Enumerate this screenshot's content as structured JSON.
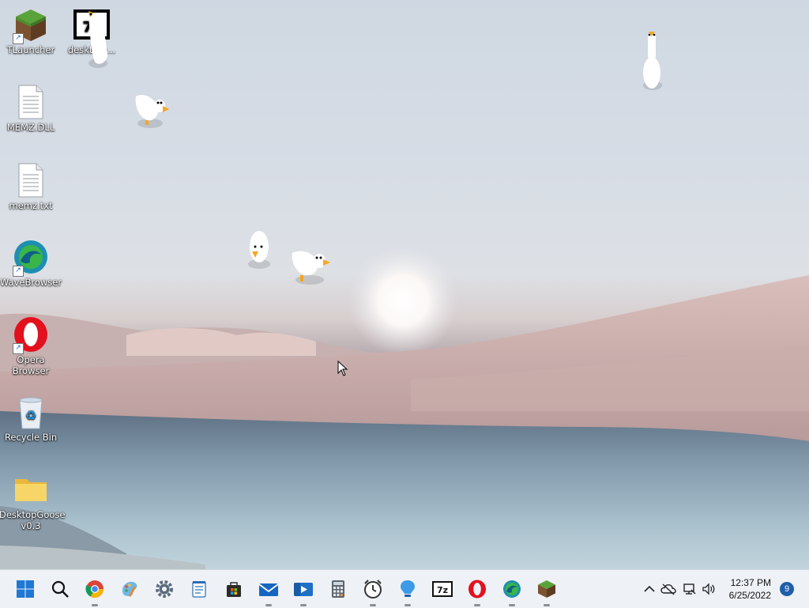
{
  "desktop": {
    "icons": [
      {
        "label": "TLauncher",
        "icon": "minecraft-grass-block-icon"
      },
      {
        "label": "deskt...o...",
        "icon": "7zip-archive-icon"
      },
      {
        "label": "MEMZ.DLL",
        "icon": "document-file-icon"
      },
      {
        "label": "memz.txt",
        "icon": "text-file-icon"
      },
      {
        "label": "WaveBrowser",
        "icon": "wavebrowser-icon"
      },
      {
        "label": "Opera Browser",
        "icon": "opera-icon"
      },
      {
        "label": "Recycle Bin",
        "icon": "recycle-bin-icon"
      },
      {
        "label": "DesktopGoose v0.3",
        "icon": "folder-icon"
      }
    ]
  },
  "taskbar": {
    "apps": [
      {
        "name": "start",
        "icon": "windows-start-icon"
      },
      {
        "name": "search",
        "icon": "search-icon"
      },
      {
        "name": "chrome",
        "icon": "chrome-icon"
      },
      {
        "name": "paint",
        "icon": "paint-icon"
      },
      {
        "name": "settings",
        "icon": "gear-icon"
      },
      {
        "name": "notepad",
        "icon": "notepad-icon"
      },
      {
        "name": "store",
        "icon": "store-icon"
      },
      {
        "name": "mail",
        "icon": "mail-icon"
      },
      {
        "name": "media-player",
        "icon": "media-player-icon"
      },
      {
        "name": "calculator",
        "icon": "calculator-icon"
      },
      {
        "name": "clock",
        "icon": "alarm-clock-icon"
      },
      {
        "name": "tips",
        "icon": "lightbulb-icon"
      },
      {
        "name": "7zip",
        "icon": "7zip-icon"
      },
      {
        "name": "opera",
        "icon": "opera-icon"
      },
      {
        "name": "wavebrowser",
        "icon": "wavebrowser-icon"
      },
      {
        "name": "minecraft",
        "icon": "minecraft-grass-block-icon"
      }
    ],
    "tray": {
      "chevron": "chevron-up-icon",
      "onedrive": "onedrive-offline-icon",
      "network": "network-icon",
      "volume": "volume-icon",
      "time": "12:37 PM",
      "date": "6/25/2022",
      "notification_count": "9"
    }
  },
  "geese_count": 5
}
